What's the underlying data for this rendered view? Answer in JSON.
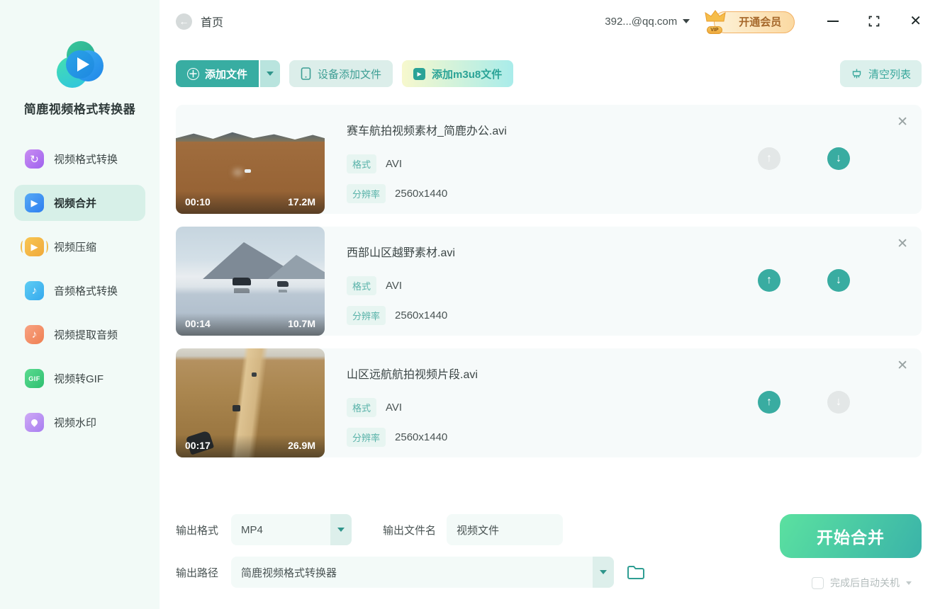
{
  "app": {
    "name": "简鹿视频格式转换器"
  },
  "topbar": {
    "page_title": "首页",
    "account_email": "392...@qq.com",
    "vip_badge": "VIP",
    "vip_button": "开通会员"
  },
  "sidebar": {
    "items": [
      {
        "label": "视频格式转换"
      },
      {
        "label": "视频合并"
      },
      {
        "label": "视频压缩"
      },
      {
        "label": "音频格式转换"
      },
      {
        "label": "视频提取音频"
      },
      {
        "label": "视频转GIF"
      },
      {
        "label": "视频水印"
      }
    ]
  },
  "toolbar": {
    "add_file": "添加文件",
    "device_add_file": "设备添加文件",
    "add_m3u8": "添加m3u8文件",
    "clear_list": "清空列表"
  },
  "labels": {
    "format": "格式",
    "resolution": "分辨率"
  },
  "files": [
    {
      "name": "赛车航拍视频素材_简鹿办公.avi",
      "duration": "00:10",
      "size": "17.2M",
      "format": "AVI",
      "resolution": "2560x1440"
    },
    {
      "name": "西部山区越野素材.avi",
      "duration": "00:14",
      "size": "10.7M",
      "format": "AVI",
      "resolution": "2560x1440"
    },
    {
      "name": "山区远航航拍视频片段.avi",
      "duration": "00:17",
      "size": "26.9M",
      "format": "AVI",
      "resolution": "2560x1440"
    }
  ],
  "output": {
    "format_label": "输出格式",
    "format_value": "MP4",
    "filename_label": "输出文件名",
    "filename_value": "视频文件",
    "path_label": "输出路径",
    "path_value": "简鹿视频格式转换器",
    "start_button": "开始合并",
    "auto_shutdown": "完成后自动关机"
  },
  "colors": {
    "primary": "#39aca1",
    "primary_light": "#dcf0ec",
    "sidebar_active_bg": "#d7f0e8",
    "start_gradient_from": "#5be1a0",
    "start_gradient_to": "#3ab3a9",
    "vip_text": "#a5672a"
  },
  "icons": {
    "gif_text": "GIF",
    "music_note": "♪",
    "refresh": "↻",
    "play": "▶"
  }
}
